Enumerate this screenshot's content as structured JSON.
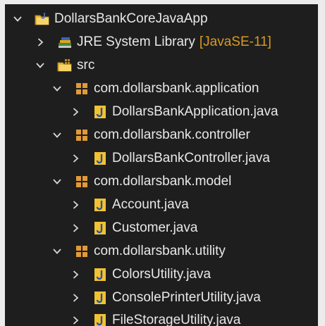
{
  "tree": [
    {
      "label": "DollarsBankCoreJavaApp",
      "kind": "project",
      "expanded": true
    },
    {
      "label": "JRE System Library",
      "decoration": "[JavaSE-11]",
      "kind": "library",
      "expanded": false
    },
    {
      "label": "src",
      "kind": "source-folder",
      "expanded": true
    },
    {
      "label": "com.dollarsbank.application",
      "kind": "package",
      "expanded": true
    },
    {
      "label": "DollarsBankApplication.java",
      "kind": "java-file",
      "expanded": false
    },
    {
      "label": "com.dollarsbank.controller",
      "kind": "package",
      "expanded": true
    },
    {
      "label": "DollarsBankController.java",
      "kind": "java-file",
      "expanded": false
    },
    {
      "label": "com.dollarsbank.model",
      "kind": "package",
      "expanded": true
    },
    {
      "label": "Account.java",
      "kind": "java-file",
      "expanded": false
    },
    {
      "label": "Customer.java",
      "kind": "java-file",
      "expanded": false
    },
    {
      "label": "com.dollarsbank.utility",
      "kind": "package",
      "expanded": true
    },
    {
      "label": "ColorsUtility.java",
      "kind": "java-file",
      "expanded": false
    },
    {
      "label": "ConsolePrinterUtility.java",
      "kind": "java-file",
      "expanded": false
    },
    {
      "label": "FileStorageUtility.java",
      "kind": "java-file",
      "expanded": false
    }
  ],
  "colors": {
    "background": "#1e1e1e",
    "text": "#e8e8e8",
    "decoration": "#d79b22",
    "package_icon": "#e0a040",
    "java_icon": "#f2c230",
    "folder_icon": "#f0c84a"
  },
  "icons": {
    "project": "project-folder-icon",
    "library": "library-books-icon",
    "source-folder": "source-folder-icon",
    "package": "package-icon",
    "java-file": "java-file-icon"
  }
}
